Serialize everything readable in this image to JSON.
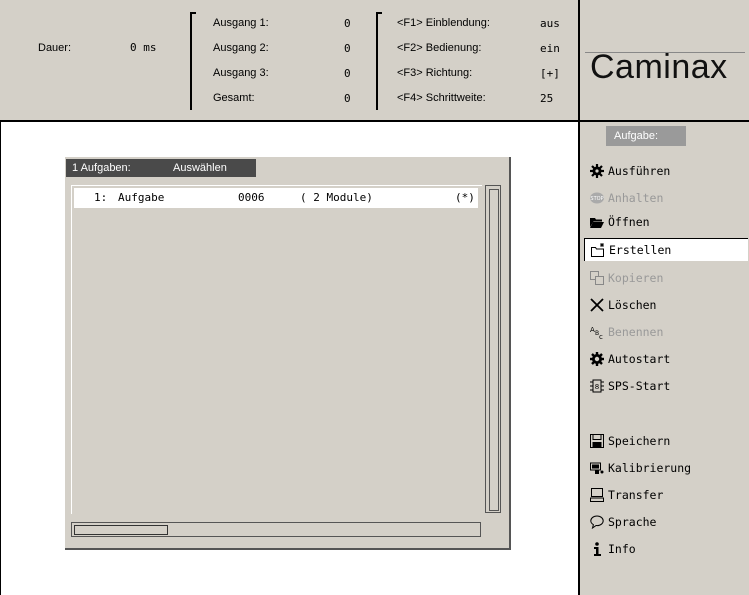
{
  "header": {
    "dauer_label": "Dauer:",
    "dauer_value": "0 ms",
    "outputs": [
      {
        "label": "Ausgang 1:",
        "value": "0"
      },
      {
        "label": "Ausgang 2:",
        "value": "0"
      },
      {
        "label": "Ausgang 3:",
        "value": "0"
      },
      {
        "label": "Gesamt:",
        "value": "0"
      }
    ],
    "fkeys": [
      {
        "label": "<F1> Einblendung:",
        "value": "aus"
      },
      {
        "label": "<F2> Bedienung:",
        "value": "ein"
      },
      {
        "label": "<F3> Richtung:",
        "value": "[+]"
      },
      {
        "label": "<F4> Schrittweite:",
        "value": "25"
      }
    ]
  },
  "logo": {
    "text": "Caminax"
  },
  "dialog": {
    "title_count": "1 Aufgaben:",
    "title_action": "Auswählen",
    "rows": [
      {
        "index": "1:",
        "name": "Aufgabe",
        "number": "0006",
        "modules": "( 2 Module)",
        "flag": "(*)"
      }
    ]
  },
  "sidebar": {
    "heading": "Aufgabe:",
    "items": [
      {
        "label": "Ausführen",
        "icon": "gear-icon",
        "enabled": true
      },
      {
        "label": "Anhalten",
        "icon": "stop-icon",
        "enabled": false
      },
      {
        "label": "Öffnen",
        "icon": "folder-open-icon",
        "enabled": true
      },
      {
        "label": "Erstellen",
        "icon": "new-folder-icon",
        "enabled": true,
        "selected": true
      },
      {
        "label": "Kopieren",
        "icon": "copy-icon",
        "enabled": false
      },
      {
        "label": "Löschen",
        "icon": "delete-x-icon",
        "enabled": true
      },
      {
        "label": "Benennen",
        "icon": "rename-abc-icon",
        "enabled": false
      },
      {
        "label": "Autostart",
        "icon": "autostart-gear-icon",
        "enabled": true
      },
      {
        "label": "SPS-Start",
        "icon": "sps-icon",
        "enabled": true
      },
      {
        "label": "Speichern",
        "icon": "save-icon",
        "enabled": true
      },
      {
        "label": "Kalibrierung",
        "icon": "calibration-icon",
        "enabled": true
      },
      {
        "label": "Transfer",
        "icon": "transfer-icon",
        "enabled": true
      },
      {
        "label": "Sprache",
        "icon": "speech-bubble-icon",
        "enabled": true
      },
      {
        "label": "Info",
        "icon": "info-icon",
        "enabled": true
      }
    ]
  }
}
